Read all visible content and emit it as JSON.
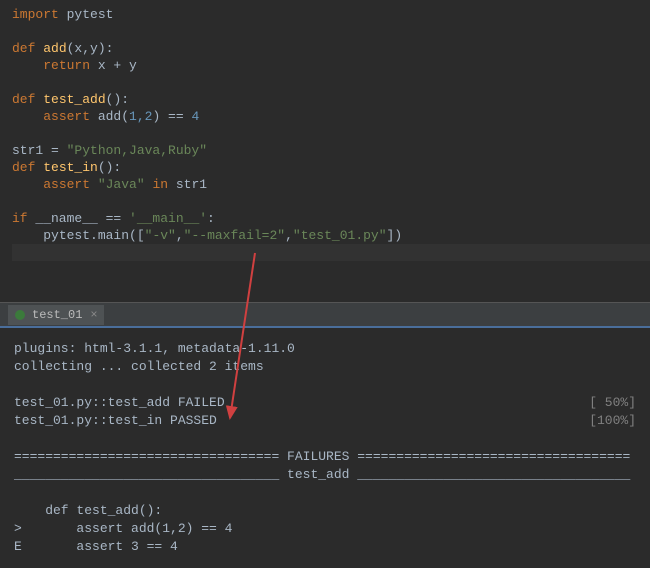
{
  "code": {
    "l1_kw": "import",
    "l1_mod": " pytest",
    "l3_kw": "def ",
    "l3_fn": "add",
    "l3_params": "(x,y):",
    "l4_indent": "    ",
    "l4_kw": "return ",
    "l4_expr": "x + y",
    "l6_kw": "def ",
    "l6_fn": "test_add",
    "l6_params": "():",
    "l7_indent": "    ",
    "l7_kw": "assert ",
    "l7_call": "add(",
    "l7_args": "1,2",
    "l7_rest": ") == ",
    "l7_num": "4",
    "l9_lhs": "str1 = ",
    "l9_str": "\"Python,Java,Ruby\"",
    "l10_kw": "def ",
    "l10_fn": "test_in",
    "l10_params": "():",
    "l11_indent": "    ",
    "l11_kw1": "assert ",
    "l11_str": "\"Java\"",
    "l11_kw2": " in ",
    "l11_var": "str1",
    "l13_kw": "if ",
    "l13_name": "__name__ == ",
    "l13_str": "'__main__'",
    "l13_colon": ":",
    "l14_indent": "    ",
    "l14_call": "pytest.main([",
    "l14_s1": "\"-v\"",
    "l14_c1": ",",
    "l14_s2": "\"--maxfail=2\"",
    "l14_c2": ",",
    "l14_s3": "\"test_01.py\"",
    "l14_end": "])"
  },
  "tab": {
    "label": "test_01",
    "close": "×"
  },
  "console": {
    "l1": "plugins: html-3.1.1, metadata-1.11.0",
    "l2": "collecting ... collected 2 items",
    "l4_left": "test_01.py::test_add FAILED",
    "l4_right": "[ 50%]",
    "l5_left": "test_01.py::test_in PASSED",
    "l5_right": "[100%]",
    "l7": "================================== FAILURES ===================================",
    "l8": "__________________________________ test_add ___________________________________",
    "l10": "    def test_add():",
    "l11": ">       assert add(1,2) == 4",
    "l12": "E       assert 3 == 4"
  }
}
